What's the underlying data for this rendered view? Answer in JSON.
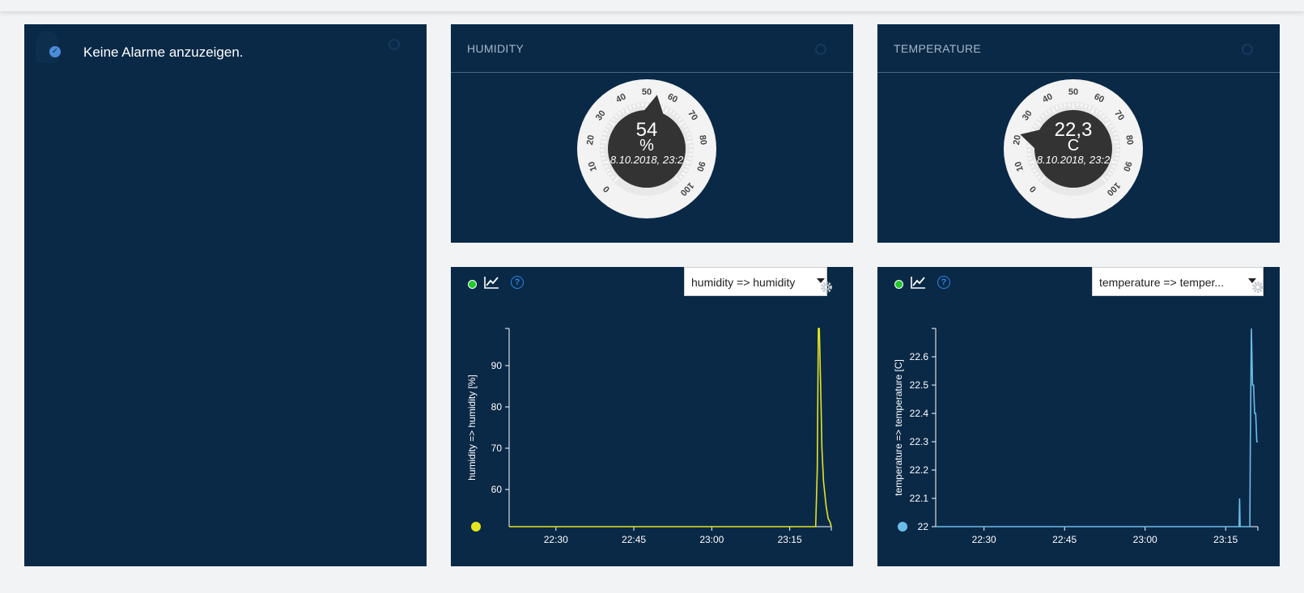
{
  "alarms": {
    "empty_text": "Keine Alarme anzuzeigen."
  },
  "humidity_gauge": {
    "title": "HUMIDITY",
    "value": 54,
    "value_text": "54",
    "unit": "%",
    "timestamp": "8.10.2018, 23:2",
    "scale_min": 0,
    "scale_max": 100,
    "ticks": [
      "0",
      "10",
      "20",
      "30",
      "40",
      "50",
      "60",
      "70",
      "80",
      "90",
      "100"
    ]
  },
  "temperature_gauge": {
    "title": "TEMPERATURE",
    "value": 22.3,
    "value_text": "22,3",
    "unit": "C",
    "timestamp": "8.10.2018, 23:2",
    "scale_min": 0,
    "scale_max": 100,
    "ticks": [
      "0",
      "10",
      "20",
      "30",
      "40",
      "50",
      "60",
      "70",
      "80",
      "90",
      "100"
    ]
  },
  "humidity_chart": {
    "series_select": "humidity => humidity",
    "series_color": "#e5e51e",
    "status_color": "#24c92e",
    "chart_data": {
      "type": "line",
      "title": "",
      "ylabel": "humidity => humidity [%]",
      "xlabel": "",
      "xlim": [
        "22:21",
        "23:23"
      ],
      "ylim": [
        51,
        99
      ],
      "xticks": [
        "22:30",
        "22:45",
        "23:00",
        "23:15"
      ],
      "yticks": [
        60,
        70,
        80,
        90
      ],
      "series": [
        {
          "color": "#e5e51e",
          "x": [
            "22:21",
            "23:20",
            "23:20.3",
            "23:20.5",
            "23:20.7",
            "23:21.0",
            "23:21.2",
            "23:21.5",
            "23:22",
            "23:22.4",
            "23:22.8",
            "23:23"
          ],
          "y": [
            51,
            51,
            65,
            99,
            99,
            82,
            70,
            62,
            56,
            53,
            52,
            51
          ]
        }
      ]
    }
  },
  "temperature_chart": {
    "series_select": "temperature => temper...",
    "series_color": "#6bbde8",
    "status_color": "#24c92e",
    "chart_data": {
      "type": "line",
      "title": "",
      "ylabel": "temperature => temperature [C]",
      "xlabel": "",
      "xlim": [
        "22:21",
        "23:21"
      ],
      "ylim": [
        22.0,
        22.7
      ],
      "xticks": [
        "22:30",
        "22:45",
        "23:00",
        "23:15"
      ],
      "yticks": [
        22,
        22.1,
        22.2,
        22.3,
        22.4,
        22.5,
        22.6
      ],
      "series": [
        {
          "color": "#6bbde8",
          "x": [
            "22:21",
            "23:17.5",
            "23:17.6",
            "23:17.7",
            "23:19.5",
            "23:19.6",
            "23:19.8",
            "23:20",
            "23:20.2",
            "23:20.4",
            "23:20.6",
            "23:20.8",
            "23:21"
          ],
          "y": [
            22.0,
            22.0,
            22.1,
            22.0,
            22.0,
            22.3,
            22.7,
            22.5,
            22.5,
            22.4,
            22.4,
            22.3,
            22.3
          ]
        }
      ]
    }
  }
}
